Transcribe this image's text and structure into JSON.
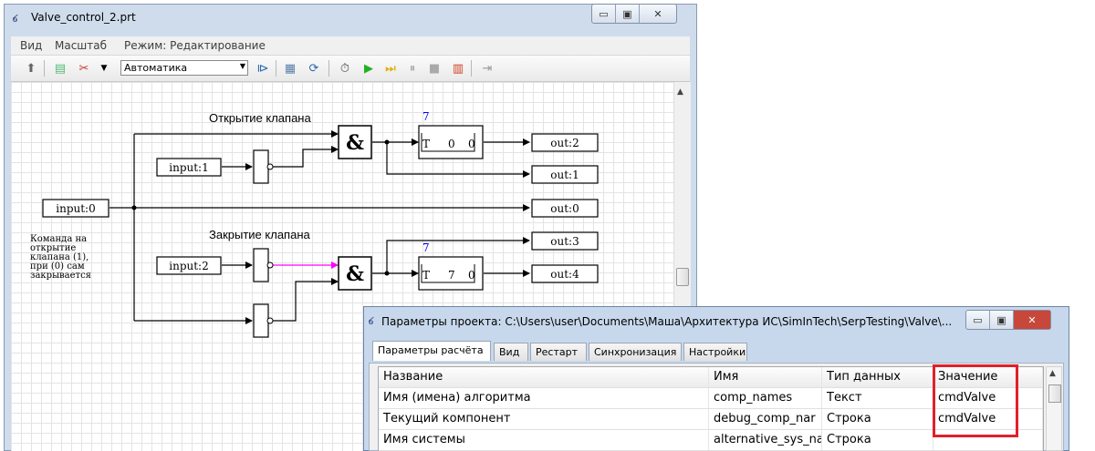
{
  "main_window": {
    "title": "Valve_control_2.prt",
    "menu": [
      "Вид",
      "Масштаб",
      "Режим: Редактирование"
    ],
    "mode_combo": "Автоматика"
  },
  "diagram": {
    "labels": {
      "open_title": "Открытие клапана",
      "close_title": "Закрытие клапана",
      "note": [
        "Команда на",
        "открытие",
        "клапана (1),",
        "при (0) сам",
        "закрывается"
      ]
    },
    "inputs": [
      "input:0",
      "input:1",
      "input:2"
    ],
    "outputs": [
      "out:2",
      "out:1",
      "out:0",
      "out:3",
      "out:4"
    ],
    "and_symbol": "&",
    "timer1": {
      "count": "7",
      "letter": "T",
      "a": "0",
      "b": "0"
    },
    "timer2": {
      "count": "7",
      "letter": "T",
      "a": "7",
      "b": "0"
    }
  },
  "dialog": {
    "title": "Параметры проекта: C:\\Users\\user\\Documents\\Маша\\Архитектура ИС\\SimInTech\\SerpTesting\\Valve\\...",
    "tabs": [
      "Параметры расчёта",
      "Вид",
      "Рестарт",
      "Синхронизация",
      "Настройки"
    ],
    "columns": [
      "Название",
      "Имя",
      "Тип данных",
      "Значение"
    ],
    "rows": [
      {
        "name": "Имя (имена) алгоритма",
        "id": "comp_names",
        "type": "Текст",
        "value": "cmdValve"
      },
      {
        "name": "Текущий компонент",
        "id": "debug_comp_nar",
        "type": "Строка",
        "value": "cmdValve"
      },
      {
        "name": "Имя системы",
        "id": "alternative_sys_na",
        "type": "Строка",
        "value": ""
      }
    ]
  },
  "colors": {
    "highlight": "#e0202a",
    "signal_magenta": "#ff00ff",
    "counter_blue": "#0000ff"
  }
}
